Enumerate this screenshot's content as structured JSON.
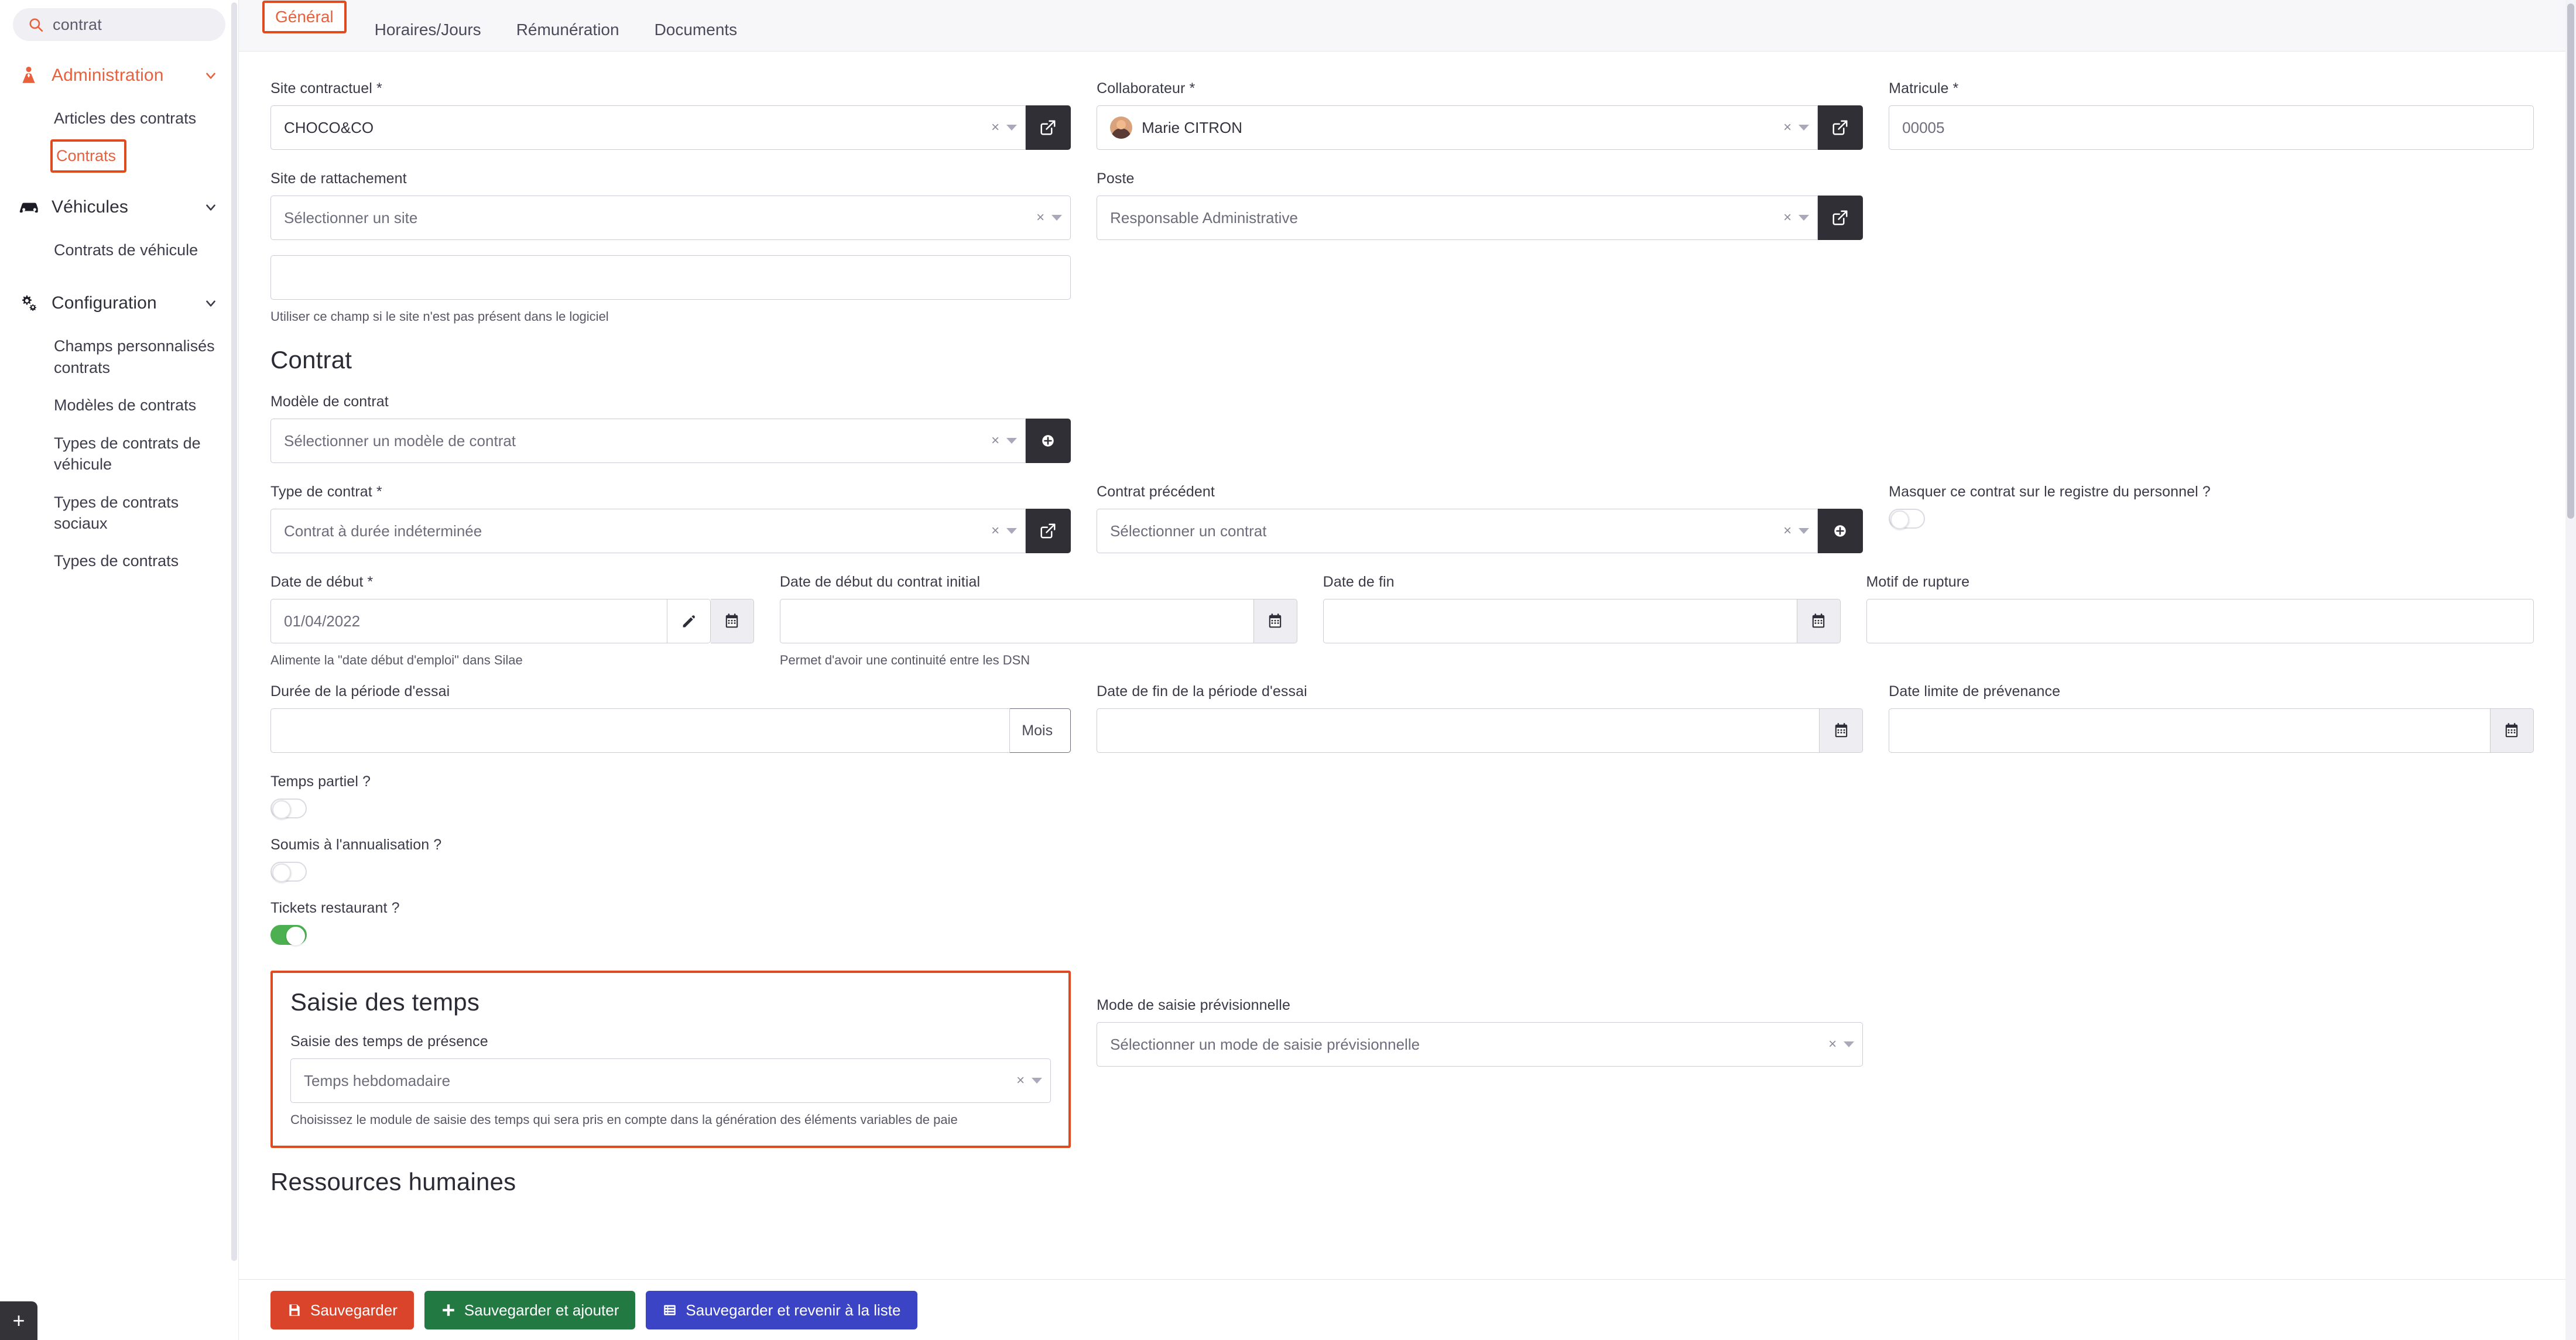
{
  "sidebar": {
    "search": {
      "value": "contrat",
      "icon": "search-icon"
    },
    "groups": [
      {
        "label": "Administration",
        "icon": "user-tie-icon",
        "active": true,
        "links": [
          {
            "label": "Articles des contrats",
            "active": false
          },
          {
            "label": "Contrats",
            "active": true
          }
        ]
      },
      {
        "label": "Véhicules",
        "icon": "car-icon",
        "active": false,
        "links": [
          {
            "label": "Contrats de véhicule",
            "active": false
          }
        ]
      },
      {
        "label": "Configuration",
        "icon": "gears-icon",
        "active": false,
        "links": [
          {
            "label": "Champs personnalisés contrats",
            "active": false
          },
          {
            "label": "Modèles de contrats",
            "active": false
          },
          {
            "label": "Types de contrats de véhicule",
            "active": false
          },
          {
            "label": "Types de contrats sociaux",
            "active": false
          },
          {
            "label": "Types de contrats",
            "active": false
          }
        ]
      }
    ],
    "fab_label": "+"
  },
  "tabs": [
    {
      "label": "Général",
      "active": true
    },
    {
      "label": "Horaires/Jours",
      "active": false
    },
    {
      "label": "Rémunération",
      "active": false
    },
    {
      "label": "Documents",
      "active": false
    }
  ],
  "form": {
    "site_contractuel": {
      "label": "Site contractuel *",
      "value": "CHOCO&CO",
      "clear": "×"
    },
    "collaborateur": {
      "label": "Collaborateur *",
      "value": "Marie CITRON",
      "clear": "×"
    },
    "matricule": {
      "label": "Matricule *",
      "value": "00005"
    },
    "site_rattachement": {
      "label": "Site de rattachement",
      "placeholder": "Sélectionner un site",
      "clear": "×"
    },
    "poste": {
      "label": "Poste",
      "value": "Responsable Administrative",
      "clear": "×"
    },
    "site_libre": {
      "label": "",
      "value": "",
      "help": "Utiliser ce champ si le site n'est pas présent dans le logiciel"
    },
    "contrat_section_title": "Contrat",
    "modele_contrat": {
      "label": "Modèle de contrat",
      "placeholder": "Sélectionner un modèle de contrat",
      "clear": "×"
    },
    "type_contrat": {
      "label": "Type de contrat *",
      "value": "Contrat à durée indéterminée",
      "clear": "×"
    },
    "contrat_precedent": {
      "label": "Contrat précédent",
      "placeholder": "Sélectionner un contrat",
      "clear": "×"
    },
    "masquer_registre": {
      "label": "Masquer ce contrat sur le registre du personnel ?",
      "on": false
    },
    "date_debut": {
      "label": "Date de début *",
      "value": "01/04/2022",
      "help": "Alimente la \"date début d'emploi\" dans Silae"
    },
    "date_debut_initial": {
      "label": "Date de début du contrat initial",
      "value": "",
      "help": "Permet d'avoir une continuité entre les DSN"
    },
    "date_fin": {
      "label": "Date de fin",
      "value": ""
    },
    "motif_rupture": {
      "label": "Motif de rupture",
      "value": ""
    },
    "duree_essai": {
      "label": "Durée de la période d'essai",
      "value": "",
      "unit": "Mois"
    },
    "date_fin_essai": {
      "label": "Date de fin de la période d'essai",
      "value": ""
    },
    "date_limite_prevenance": {
      "label": "Date limite de prévenance",
      "value": ""
    },
    "temps_partiel": {
      "label": "Temps partiel ?",
      "on": false
    },
    "annualisation": {
      "label": "Soumis à l'annualisation ?",
      "on": false
    },
    "tickets_restaurant": {
      "label": "Tickets restaurant ?",
      "on": true
    },
    "saisie_section_title": "Saisie des temps",
    "saisie_presence": {
      "label": "Saisie des temps de présence",
      "value": "Temps hebdomadaire",
      "clear": "×",
      "help": "Choisissez le module de saisie des temps qui sera pris en compte dans la génération des éléments variables de paie"
    },
    "mode_previsionnelle": {
      "label": "Mode de saisie prévisionnelle",
      "placeholder": "Sélectionner un mode de saisie prévisionnelle",
      "clear": "×"
    },
    "rh_section_title": "Ressources humaines"
  },
  "footer": {
    "save": "Sauvegarder",
    "save_add": "Sauvegarder et ajouter",
    "save_back": "Sauvegarder et revenir à la liste"
  },
  "colors": {
    "accent": "#e8603c",
    "highlight": "#e04a1f",
    "toggle_on": "#4caf50",
    "btn_red": "#d9442b",
    "btn_green": "#227a42",
    "btn_blue": "#3b44c4"
  }
}
